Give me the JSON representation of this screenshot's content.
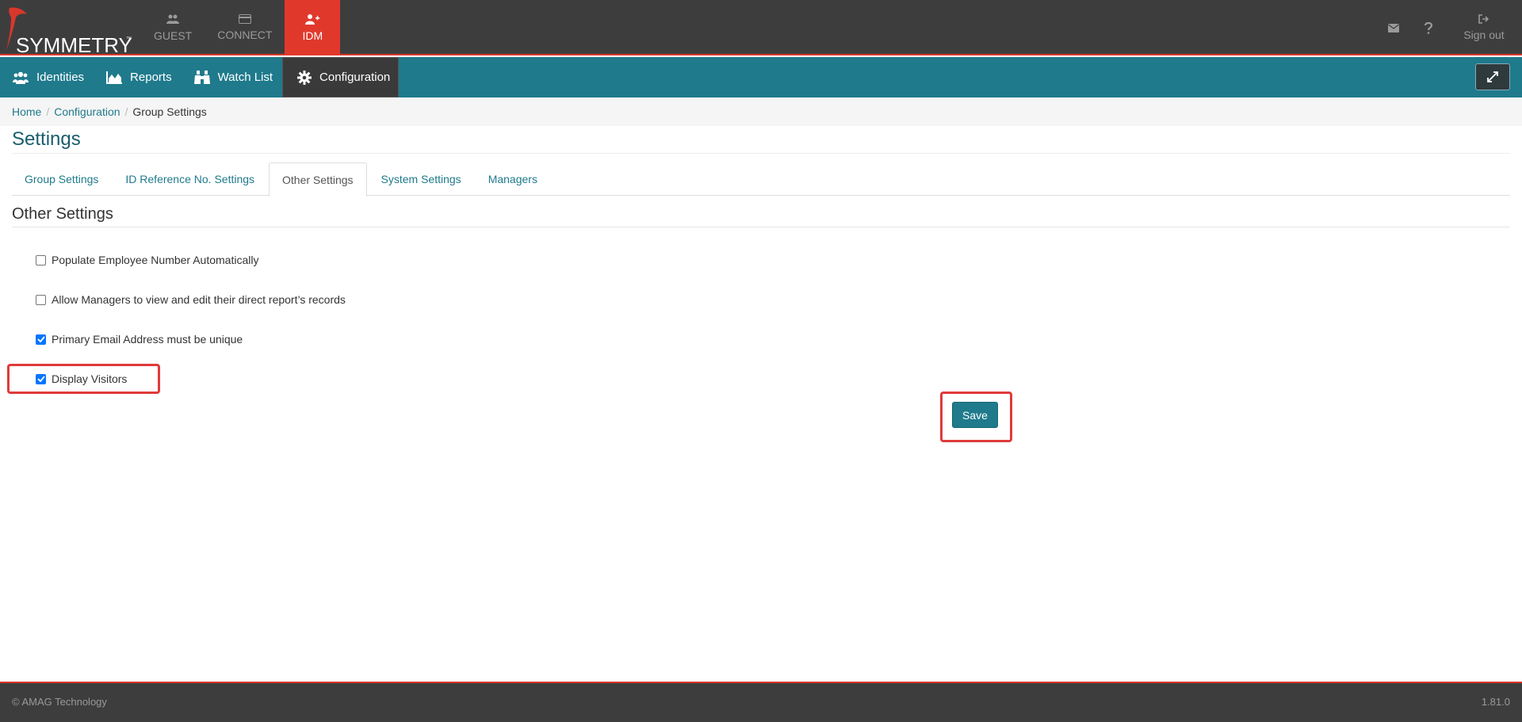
{
  "brand": {
    "name": "SYMMETRY",
    "tm": "™",
    "accent_color": "#e0392c"
  },
  "topnav": {
    "items": [
      {
        "label": "GUEST",
        "icon": "users-icon"
      },
      {
        "label": "CONNECT",
        "icon": "card-icon"
      },
      {
        "label": "IDM",
        "icon": "user-plus-icon",
        "active": true
      }
    ],
    "mail_icon": "envelope-icon",
    "help_icon": "question-icon",
    "signout_label": "Sign out"
  },
  "mainnav": {
    "items": [
      {
        "label": "Identities",
        "icon": "users-icon"
      },
      {
        "label": "Reports",
        "icon": "area-chart-icon"
      },
      {
        "label": "Watch List",
        "icon": "binoculars-icon"
      },
      {
        "label": "Configuration",
        "icon": "gear-icon",
        "active": true
      }
    ],
    "bg_color": "#1f7a8c"
  },
  "breadcrumb": {
    "home": "Home",
    "configuration": "Configuration",
    "current": "Group Settings"
  },
  "page_title": "Settings",
  "tabs": [
    "Group Settings",
    "ID Reference No. Settings",
    "Other Settings",
    "System Settings",
    "Managers"
  ],
  "active_tab": "Other Settings",
  "section_title": "Other Settings",
  "options": [
    {
      "label": "Populate Employee Number Automatically",
      "checked": false
    },
    {
      "label": "Allow Managers to view and edit their direct report’s records",
      "checked": false
    },
    {
      "label": "Primary Email Address must be unique",
      "checked": true
    },
    {
      "label": "Display Visitors",
      "checked": true
    }
  ],
  "save_label": "Save",
  "footer": {
    "copyright": "© AMAG Technology",
    "version": "1.81.0"
  }
}
